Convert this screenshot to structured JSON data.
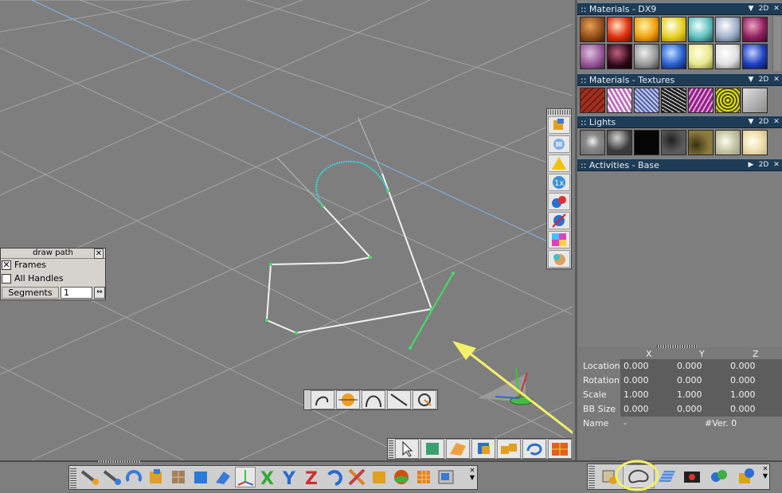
{
  "panels": {
    "materials_dx9": {
      "title": ":: Materials - DX9",
      "mode": "2D"
    },
    "materials_textures": {
      "title": ":: Materials - Textures",
      "mode": "2D"
    },
    "lights": {
      "title": ":: Lights",
      "mode": "2D"
    },
    "activities": {
      "title": ":: Activities - Base",
      "mode": "2D"
    }
  },
  "draw_path": {
    "title": "draw path",
    "frames_label": "Frames",
    "frames_checked": true,
    "all_handles_label": "All Handles",
    "all_handles_checked": false,
    "segments_label": "Segments",
    "segments_value": "1"
  },
  "properties": {
    "col_x": "X",
    "col_y": "Y",
    "col_z": "Z",
    "rows": [
      {
        "label": "Location",
        "x": "0.000",
        "y": "0.000",
        "z": "0.000"
      },
      {
        "label": "Rotation",
        "x": "0.000",
        "y": "0.000",
        "z": "0.000"
      },
      {
        "label": "Scale",
        "x": "1.000",
        "y": "1.000",
        "z": "1.000"
      },
      {
        "label": "BB Size",
        "x": "0.000",
        "y": "0.000",
        "z": "0.000"
      }
    ],
    "name_label": "Name",
    "name_value": "-",
    "version": "#Ver. 0"
  },
  "colors": {
    "panel_header": "#1e3c55",
    "viewport_bg": "#7e7e7e",
    "path_cyan": "#35d6d6",
    "path_green": "#44dd66",
    "annotation_yellow": "#f4f06a"
  },
  "icons": {
    "close": "close-icon",
    "arrow": "chevron-down-icon",
    "arrow_right": "chevron-right-icon"
  }
}
